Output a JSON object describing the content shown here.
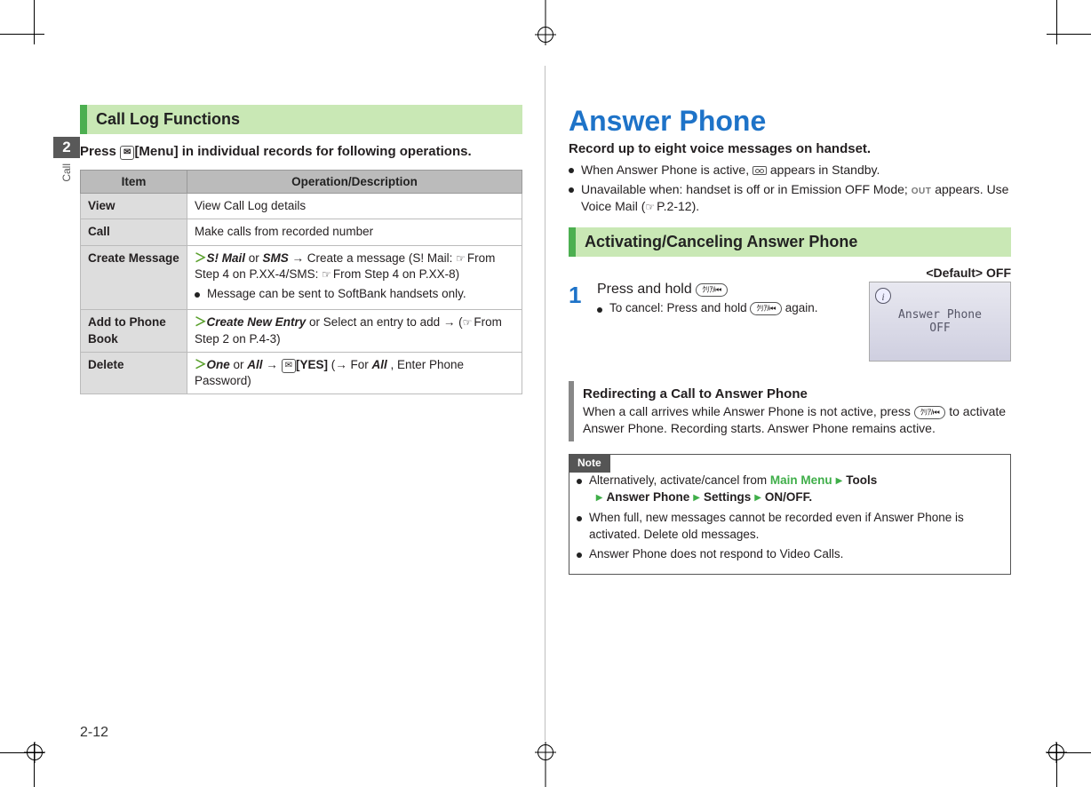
{
  "sideTab": {
    "number": "2",
    "label": "Call"
  },
  "left": {
    "heading": "Call Log Functions",
    "instruction_pre": "Press ",
    "instruction_key": "✉",
    "instruction_post": "[Menu] in individual records for following operations.",
    "table": {
      "head_item": "Item",
      "head_op": "Operation/Description",
      "rows": {
        "view": {
          "item": "View",
          "desc": "View Call Log details"
        },
        "call": {
          "item": "Call",
          "desc": "Make calls from recorded number"
        },
        "create": {
          "item": "Create Message",
          "line1_pre": "S! Mail",
          "line1_or": " or ",
          "line1_sms": "SMS",
          "line1_arrow": " → Create a message (S! Mail: ",
          "line1_ref1": "From Step 4 on P.XX-4/SMS: ",
          "line1_ref2": "From Step 4 on P.XX-8)",
          "bullet": "Message can be sent to SoftBank handsets only."
        },
        "add": {
          "item": "Add to Phone Book",
          "line_pre": "Create New Entry",
          "line_mid": " or Select an entry to add → (",
          "line_ref": "From Step 2 on P.4-3)"
        },
        "delete": {
          "item": "Delete",
          "pre": "One",
          "or": " or ",
          "all": "All",
          "after": " → ",
          "key": "✉",
          "yes": "[YES]",
          "tail1": " (→ For ",
          "tail_all": "All",
          "tail2": " , Enter Phone Password)"
        }
      }
    }
  },
  "right": {
    "title": "Answer Phone",
    "lead": "Record up to eight voice messages on handset.",
    "b1_pre": "When Answer Phone is active, ",
    "b1_post": " appears in Standby.",
    "b2_pre": "Unavailable when: handset is off or in Emission OFF Mode; ",
    "b2_out": "OUT",
    "b2_post": " appears. Use Voice Mail (",
    "b2_ref": "P.2-12).",
    "subhead": "Activating/Canceling Answer Phone",
    "default": "<Default> OFF",
    "step1_num": "1",
    "step1_text_pre": "Press and hold ",
    "step1_key": "ｸﾘｱ/⏮",
    "step1_sub_pre": "To cancel: Press and hold ",
    "step1_sub_post": " again.",
    "shot_line1": "Answer Phone",
    "shot_line2": "OFF",
    "redir_title": "Redirecting a Call to Answer Phone",
    "redir_body_pre": "When a call arrives while Answer Phone is not active, press ",
    "redir_body_post": " to activate Answer Phone. Recording starts. Answer Phone remains active.",
    "note_label": "Note",
    "note1_pre": "Alternatively, activate/cancel from ",
    "note1_mm": "Main Menu",
    "note1_tools": "Tools",
    "note1_ap": "Answer Phone",
    "note1_settings": "Settings",
    "note1_onoff": "ON/OFF.",
    "note2": "When full, new messages cannot be recorded even if Answer Phone is activated. Delete old messages.",
    "note3": "Answer Phone does not respond to Video Calls."
  },
  "pageNumber": "2-12"
}
